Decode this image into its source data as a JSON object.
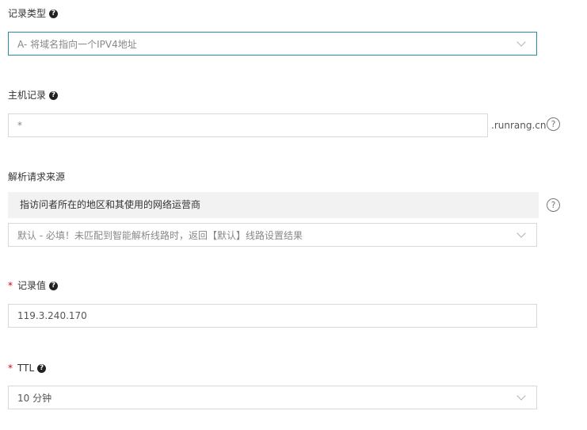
{
  "record_type": {
    "label": "记录类型",
    "value": "A- 将域名指向一个IPV4地址"
  },
  "host_record": {
    "label": "主机记录",
    "value": "*",
    "domain_suffix": ".runrang.cn"
  },
  "resolution_source": {
    "label": "解析请求来源",
    "hint": "指访问者所在的地区和其使用的网络运营商",
    "value": "默认 - 必填！未匹配到智能解析线路时，返回【默认】线路设置结果"
  },
  "record_value": {
    "required_mark": "*",
    "label": "记录值",
    "value": "119.3.240.170"
  },
  "ttl": {
    "required_mark": "*",
    "label": "TTL",
    "value": "10 分钟"
  },
  "icons": {
    "help_filled": "question-circle-filled",
    "help_outline": "question-circle-outline",
    "dropdown": "chevron-down"
  },
  "colors": {
    "focus_border": "#2a8aa8",
    "required": "#d0021b",
    "hint_bg": "#f2f2f2"
  }
}
